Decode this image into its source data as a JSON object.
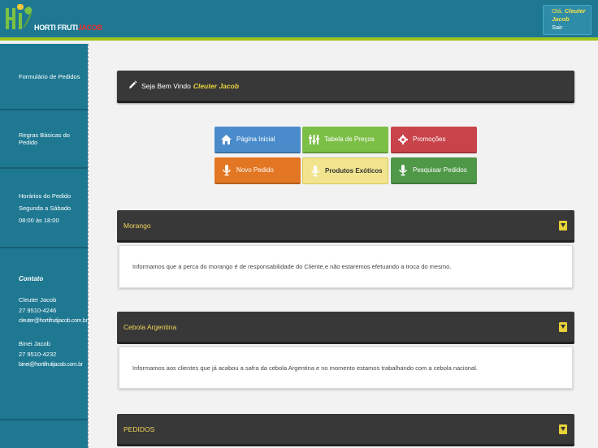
{
  "header": {
    "logo_text_main": "HORTI FRUTI",
    "logo_text_accent": "JACOB",
    "greeting": "Olá,",
    "user_name": "Cleuter Jacob",
    "logout_label": "Sair"
  },
  "sidebar": {
    "order_form": "Formulário de Pedidos",
    "basic_rules": "Regras Básicas do Pedido",
    "hours_title": "Horários do Pedido",
    "hours_days": "Segunda a Sábado",
    "hours_time": "08:00 às 18:00",
    "contact_heading": "Contato",
    "contacts": [
      {
        "name": "Cleuter Jacob",
        "phone": "27 9510-4246",
        "email": "cleuter@hortifrutijacob.com.br"
      },
      {
        "name": "Binei Jacob",
        "phone": "27 9510-4232",
        "email": "binei@hortifrutijacob.com.br"
      }
    ]
  },
  "welcome": {
    "text": "Seja Bem Vindo",
    "name": "Cleuter Jacob"
  },
  "buttons": {
    "home": "Página Inicial",
    "prices": "Tabela de Preços",
    "promotions": "Promoções",
    "new_order": "Novo Pedido",
    "exotic": "Produtos Exóticos",
    "search_orders": "Pesquisar Pedidos"
  },
  "sections": [
    {
      "title": "Morango",
      "body": "Informamos que a perca do morango é de responsabilidade do Cliente,e não estaremos efetuando a troca do mesmo."
    },
    {
      "title": "Cebola Argentina",
      "body": "Informamos aos clientes que já acabou a safra da cebola Argentina e no momento estamos trabalhando com a cebola nacional."
    },
    {
      "title": "PEDIDOS"
    }
  ],
  "colors": {
    "header_bg": "#1e7892",
    "accent_line": "#9cc51e",
    "panel_dark": "#383838",
    "highlight_yellow": "#e8d13a"
  },
  "icons": {
    "home": "home-icon",
    "prices": "sliders-icon",
    "promotions": "gear-icon",
    "new_order": "microphone-icon",
    "exotic": "microphone-icon",
    "search_orders": "microphone-icon",
    "welcome": "pencil-icon",
    "expand": "chevron-down-icon"
  }
}
